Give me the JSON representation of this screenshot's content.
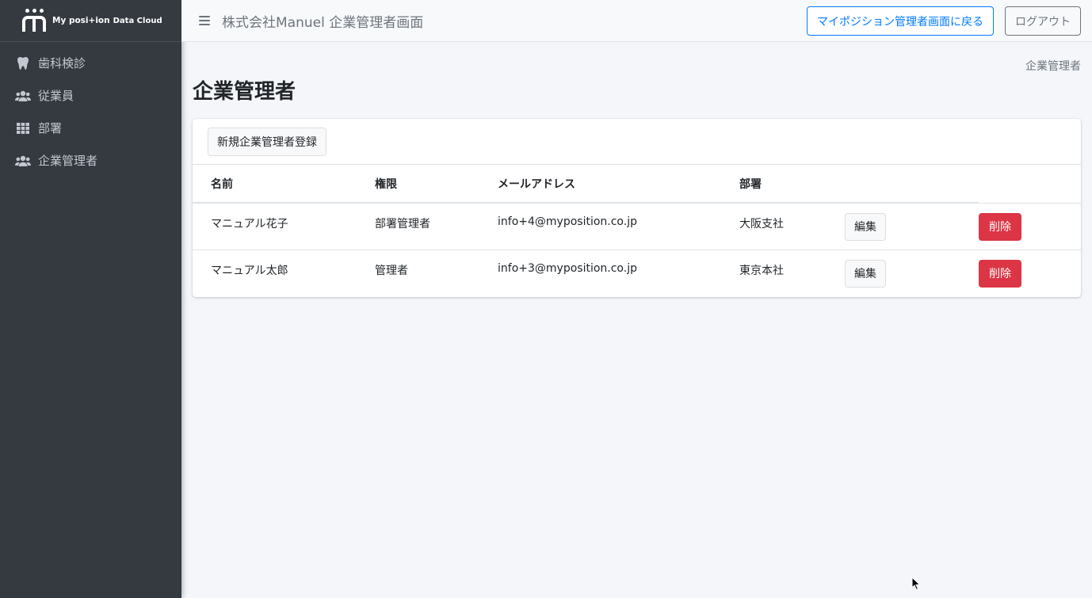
{
  "brand": {
    "name": "My posi+ion",
    "sub": "Data Cloud"
  },
  "sidebar": {
    "items": [
      {
        "label": "歯科検診",
        "icon": "tooth-icon"
      },
      {
        "label": "従業員",
        "icon": "users-icon"
      },
      {
        "label": "部署",
        "icon": "grid-icon"
      },
      {
        "label": "企業管理者",
        "icon": "users-icon"
      }
    ]
  },
  "header": {
    "title": "株式会社Manuel 企業管理者画面",
    "back_button": "マイポジション管理者画面に戻る",
    "logout_button": "ログアウト"
  },
  "breadcrumb": "企業管理者",
  "page_title": "企業管理者",
  "card": {
    "new_button": "新規企業管理者登録",
    "columns": [
      "名前",
      "権限",
      "メールアドレス",
      "部署"
    ],
    "rows": [
      {
        "name": "マニュアル花子",
        "role": "部署管理者",
        "email": "info+4@myposition.co.jp",
        "dept": "大阪支社",
        "edit": "編集",
        "delete": "削除"
      },
      {
        "name": "マニュアル太郎",
        "role": "管理者",
        "email": "info+3@myposition.co.jp",
        "dept": "東京本社",
        "edit": "編集",
        "delete": "削除"
      }
    ]
  },
  "colors": {
    "sidebar": "#343a40",
    "primary": "#007bff",
    "danger": "#dc3545"
  }
}
